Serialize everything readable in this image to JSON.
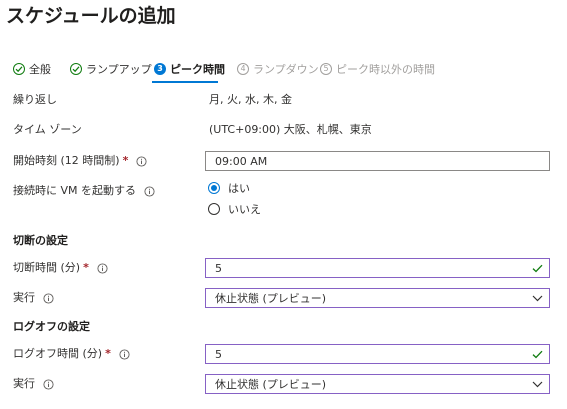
{
  "page": {
    "title": "スケジュールの追加"
  },
  "steps": [
    {
      "label": "全般",
      "number": "1",
      "state": "done"
    },
    {
      "label": "ランプアップ",
      "number": "2",
      "state": "done"
    },
    {
      "label": "ピーク時間",
      "number": "3",
      "state": "active"
    },
    {
      "label": "ランプダウン",
      "number": "4",
      "state": "todo"
    },
    {
      "label": "ピーク時以外の時間",
      "number": "5",
      "state": "todo"
    }
  ],
  "form": {
    "repeat": {
      "label": "繰り返し",
      "value": "月, 火, 水, 木, 金"
    },
    "timezone": {
      "label": "タイム ゾーン",
      "value": "(UTC+09:00) 大阪、札幌、東京"
    },
    "start_time": {
      "label": "開始時刻 (12 時間制)",
      "required": "*",
      "value": "09:00 AM"
    },
    "start_vm": {
      "label": "接続時に VM を起動する",
      "options": [
        "はい",
        "いいえ"
      ],
      "selected": "はい"
    }
  },
  "disconnect": {
    "heading": "切断の設定",
    "time": {
      "label": "切断時間 (分)",
      "required": "*",
      "value": "5"
    },
    "action": {
      "label": "実行",
      "value": "休止状態 (プレビュー)"
    }
  },
  "logoff": {
    "heading": "ログオフの設定",
    "time": {
      "label": "ログオフ時間 (分)",
      "required": "*",
      "value": "5"
    },
    "action": {
      "label": "実行",
      "value": "休止状態 (プレビュー)"
    }
  },
  "colors": {
    "accent": "#0078d4",
    "success": "#107c10",
    "valid_border": "#8661c5",
    "required": "#a4262c",
    "disabled": "#a19f9d"
  },
  "icons": {
    "done_step": "checkmark-icon",
    "info": "info-icon",
    "valid": "checkmark-icon",
    "dropdown": "chevron-down-icon"
  }
}
